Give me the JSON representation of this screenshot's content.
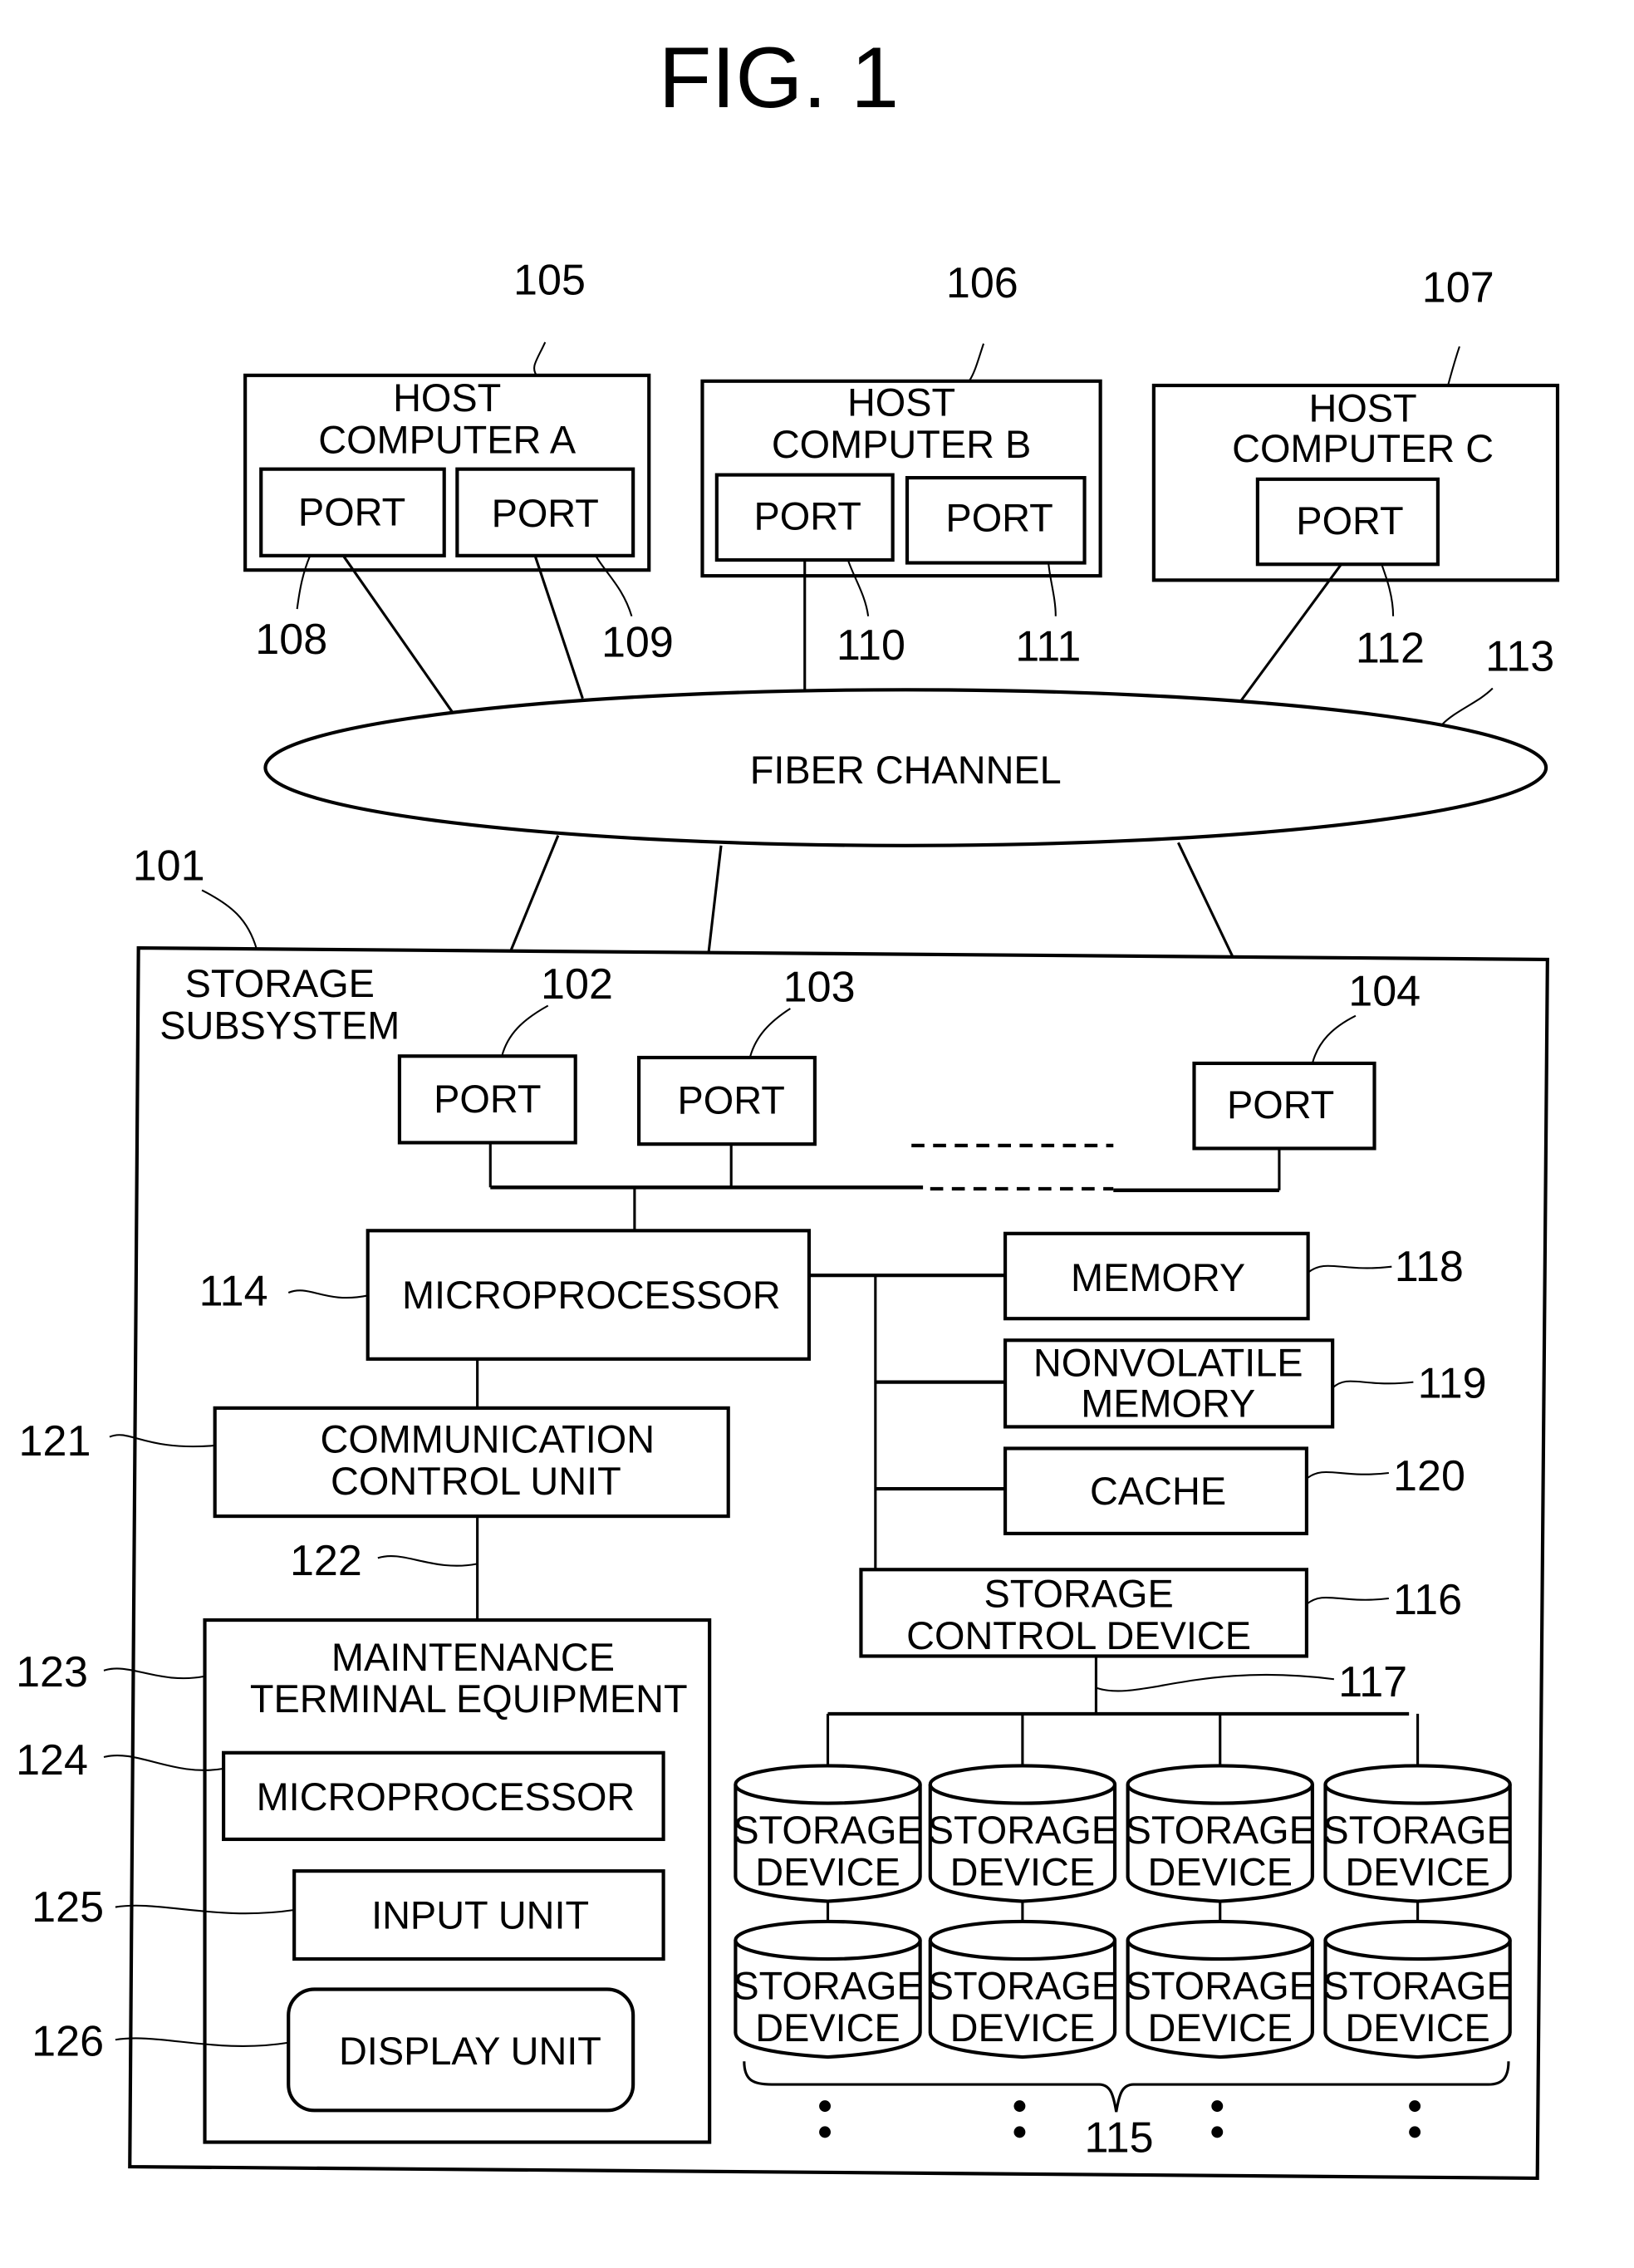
{
  "figure": {
    "title": "FIG. 1"
  },
  "hosts": [
    {
      "ref": "105",
      "line1": "HOST",
      "line2": "COMPUTER  A",
      "ports": [
        {
          "label": "PORT",
          "ref": "108"
        },
        {
          "label": "PORT",
          "ref": "109"
        }
      ]
    },
    {
      "ref": "106",
      "line1": "HOST",
      "line2": "COMPUTER  B",
      "ports": [
        {
          "label": "PORT",
          "ref": "110"
        },
        {
          "label": "PORT",
          "ref": "111"
        }
      ]
    },
    {
      "ref": "107",
      "line1": "HOST",
      "line2": "COMPUTER  C",
      "ports": [
        {
          "label": "PORT",
          "ref": "112"
        }
      ]
    }
  ],
  "network": {
    "label": "FIBER  CHANNEL",
    "ref": "113"
  },
  "storage_subsystem": {
    "ref": "101",
    "line1": "STORAGE",
    "line2": "SUBSYSTEM",
    "ports": [
      {
        "label": "PORT",
        "ref": "102"
      },
      {
        "label": "PORT",
        "ref": "103"
      },
      {
        "label": "PORT",
        "ref": "104"
      }
    ],
    "microprocessor": {
      "label": "MICROPROCESSOR",
      "ref": "114"
    },
    "memory": {
      "label": "MEMORY",
      "ref": "118"
    },
    "nonvolatile_memory": {
      "line1": "NONVOLATILE",
      "line2": "MEMORY",
      "ref": "119"
    },
    "cache": {
      "label": "CACHE",
      "ref": "120"
    },
    "storage_control": {
      "line1": "STORAGE",
      "line2": "CONTROL  DEVICE",
      "ref": "116"
    },
    "bus_ref": "117",
    "storage_devices": {
      "ref": "115",
      "line1": "STORAGE",
      "line2": "DEVICE",
      "rows": 2,
      "columns": 4
    },
    "communication_control": {
      "line1": "COMMUNICATION",
      "line2": "CONTROL  UNIT",
      "ref": "121"
    },
    "link_ref": "122",
    "maintenance_terminal": {
      "line1": "MAINTENANCE",
      "line2": "TERMINAL  EQUIPMENT",
      "ref": "123",
      "microprocessor": {
        "label": "MICROPROCESSOR",
        "ref": "124"
      },
      "input_unit": {
        "label": "INPUT  UNIT",
        "ref": "125"
      },
      "display_unit": {
        "label": "DISPLAY  UNIT",
        "ref": "126"
      }
    }
  }
}
